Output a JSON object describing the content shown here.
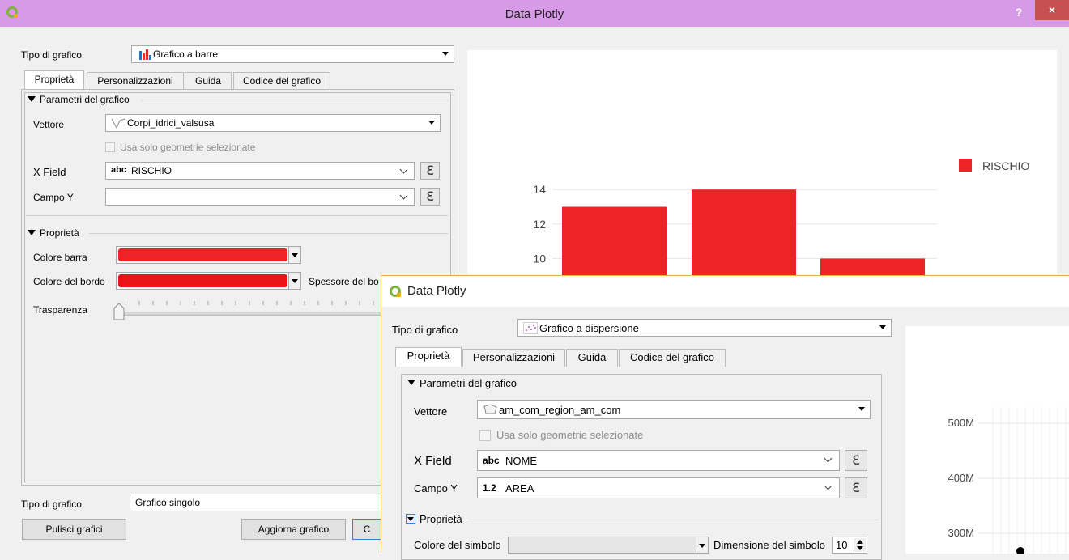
{
  "window1": {
    "title": "Data Plotly",
    "help": "?",
    "close": "×",
    "chart_type_label": "Tipo di grafico",
    "chart_type_value": "Grafico a barre",
    "tabs": [
      "Proprietà",
      "Personalizzazioni",
      "Guida",
      "Codice del grafico"
    ],
    "params_section": "Parametri del grafico",
    "layer_label": "Vettore",
    "layer_value": "Corpi_idrici_valsusa",
    "selected_only": "Usa solo geometrie selezionate",
    "x_field_label": "X Field",
    "x_field_type": "abc",
    "x_field_value": "RISCHIO",
    "y_field_label": "Campo Y",
    "y_field_value": "",
    "props_section": "Proprietà",
    "bar_color_label": "Colore barra",
    "border_color_label": "Colore del bordo",
    "border_width_label": "Spessore del bo",
    "transparency_label": "Trasparenza",
    "transparency_value": 0,
    "plot_type_label": "Tipo di grafico",
    "plot_type_value": "Grafico singolo",
    "clear_button": "Pulisci grafici",
    "update_button": "Aggiorna grafico",
    "third_button": "C"
  },
  "window2": {
    "title": "Data Plotly",
    "chart_type_label": "Tipo di grafico",
    "chart_type_value": "Grafico a dispersione",
    "tabs": [
      "Proprietà",
      "Personalizzazioni",
      "Guida",
      "Codice del grafico"
    ],
    "params_section": "Parametri del grafico",
    "layer_label": "Vettore",
    "layer_value": "am_com_region_am_com",
    "selected_only": "Usa solo geometrie selezionate",
    "x_field_label": "X Field",
    "x_field_type": "abc",
    "x_field_value": "NOME",
    "y_field_label": "Campo Y",
    "y_field_type": "1.2",
    "y_field_value": "AREA",
    "props_section": "Proprietà",
    "symbol_color_label": "Colore del simbolo",
    "symbol_size_label": "Dimensione del simbolo",
    "symbol_size_value": "10"
  },
  "colors": {
    "bar": "#ee2326",
    "titlebar": "#d79ae6",
    "close": "#c75050"
  },
  "chart_data": [
    {
      "type": "bar",
      "categories": [
        "",
        "",
        ""
      ],
      "values": [
        13,
        14,
        10
      ],
      "ylim": [
        8,
        15
      ],
      "yticks": [
        "14",
        "12",
        "10"
      ],
      "legend": [
        "RISCHIO"
      ],
      "legend_position": "top-right",
      "grid": true
    },
    {
      "type": "scatter",
      "yticks": [
        "500M",
        "400M",
        "300M"
      ],
      "ylim": [
        250000000,
        550000000
      ],
      "grid": true
    }
  ]
}
